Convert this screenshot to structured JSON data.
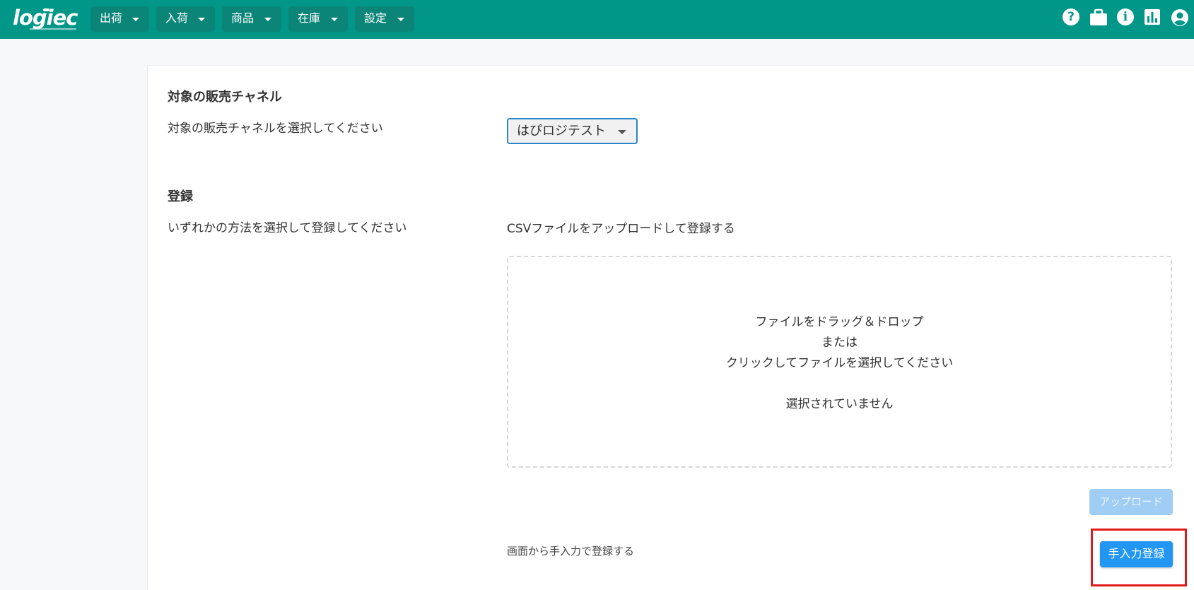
{
  "header": {
    "logo_text": "logiec",
    "menus": [
      {
        "label": "出荷"
      },
      {
        "label": "入荷"
      },
      {
        "label": "商品"
      },
      {
        "label": "在庫"
      },
      {
        "label": "設定"
      }
    ],
    "icons": [
      "help-icon",
      "briefcase-icon",
      "info-icon",
      "bar-chart-icon",
      "account-icon"
    ]
  },
  "channel_section": {
    "title": "対象の販売チャネル",
    "description": "対象の販売チャネルを選択してください",
    "selected_channel": "はぴロジテスト"
  },
  "register_section": {
    "title": "登録",
    "description": "いずれかの方法を選択して登録してください",
    "csv_heading": "CSVファイルをアップロードして登録する",
    "dropzone": {
      "line1": "ファイルをドラッグ＆ドロップ",
      "line2": "または",
      "line3": "クリックしてファイルを選択してください",
      "status": "選択されていません"
    },
    "upload_button": "アップロード",
    "manual_label": "画面から手入力で登録する",
    "manual_button": "手入力登録"
  },
  "colors": {
    "header_bg": "#009688",
    "primary_button": "#2196f3",
    "disabled_button": "#9fcdf3",
    "highlight": "#e01a1a"
  }
}
